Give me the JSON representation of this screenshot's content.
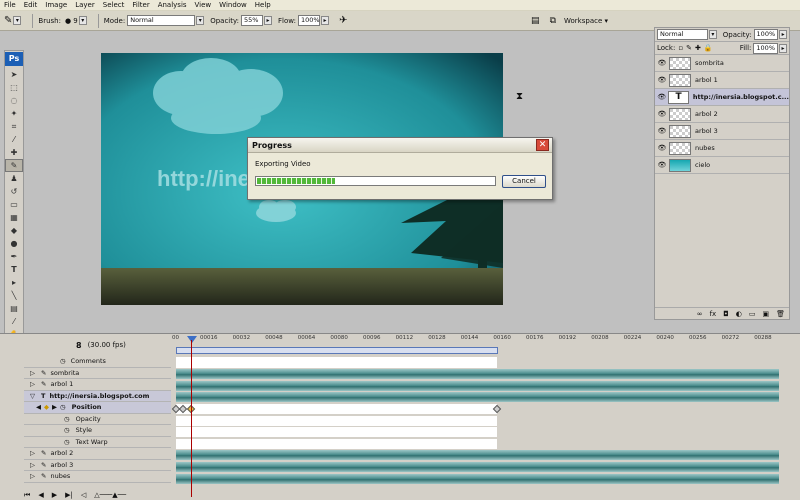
{
  "menu": [
    "File",
    "Edit",
    "Image",
    "Layer",
    "Select",
    "Filter",
    "Analysis",
    "View",
    "Window",
    "Help"
  ],
  "options": {
    "brush_label": "Brush:",
    "brush_size": "9",
    "mode_label": "Mode:",
    "mode_value": "Normal",
    "opacity_label": "Opacity:",
    "opacity_value": "55%",
    "flow_label": "Flow:",
    "flow_value": "100%",
    "workspace_label": "Workspace ▾"
  },
  "toolbox": {
    "logo": "Ps"
  },
  "canvas": {
    "url_text": "http://ine",
    "sky_color": "#2aa8b0",
    "ground_color": "#3b3f2c"
  },
  "dialog": {
    "title": "Progress",
    "message": "Exporting Video",
    "progress": 0.33,
    "cancel_label": "Cancel"
  },
  "layers": {
    "blend_mode": "Normal",
    "opacity_label": "Opacity:",
    "opacity_value": "100%",
    "lock_label": "Lock:",
    "fill_label": "Fill:",
    "fill_value": "100%",
    "items": [
      {
        "name": "sombrita",
        "type": "pixel"
      },
      {
        "name": "arbol 1",
        "type": "pixel"
      },
      {
        "name": "http://inersia.blogspot.c...",
        "type": "text",
        "selected": true
      },
      {
        "name": "arbol 2",
        "type": "pixel"
      },
      {
        "name": "arbol 3",
        "type": "pixel"
      },
      {
        "name": "nubes",
        "type": "pixel"
      },
      {
        "name": "cielo",
        "type": "fill"
      }
    ]
  },
  "timeline": {
    "current_frame": "8",
    "fps": "(30.00 fps)",
    "ruler_ticks": [
      "00",
      "00016",
      "00032",
      "00048",
      "00064",
      "00080",
      "00096",
      "00112",
      "00128",
      "00144",
      "00160",
      "00176",
      "00192",
      "00208",
      "00224",
      "00240",
      "00256",
      "00272",
      "00288"
    ],
    "rows": [
      {
        "label": "Comments",
        "kind": "global"
      },
      {
        "label": "sombrita",
        "kind": "layer"
      },
      {
        "label": "arbol 1",
        "kind": "layer"
      },
      {
        "label": "http://inersia.blogspot.com",
        "kind": "layer-open"
      },
      {
        "label": "Position",
        "kind": "prop-active"
      },
      {
        "label": "Opacity",
        "kind": "prop"
      },
      {
        "label": "Style",
        "kind": "prop"
      },
      {
        "label": "Text Warp",
        "kind": "prop"
      },
      {
        "label": "arbol 2",
        "kind": "layer"
      },
      {
        "label": "arbol 3",
        "kind": "layer"
      },
      {
        "label": "nubes",
        "kind": "layer"
      }
    ]
  }
}
